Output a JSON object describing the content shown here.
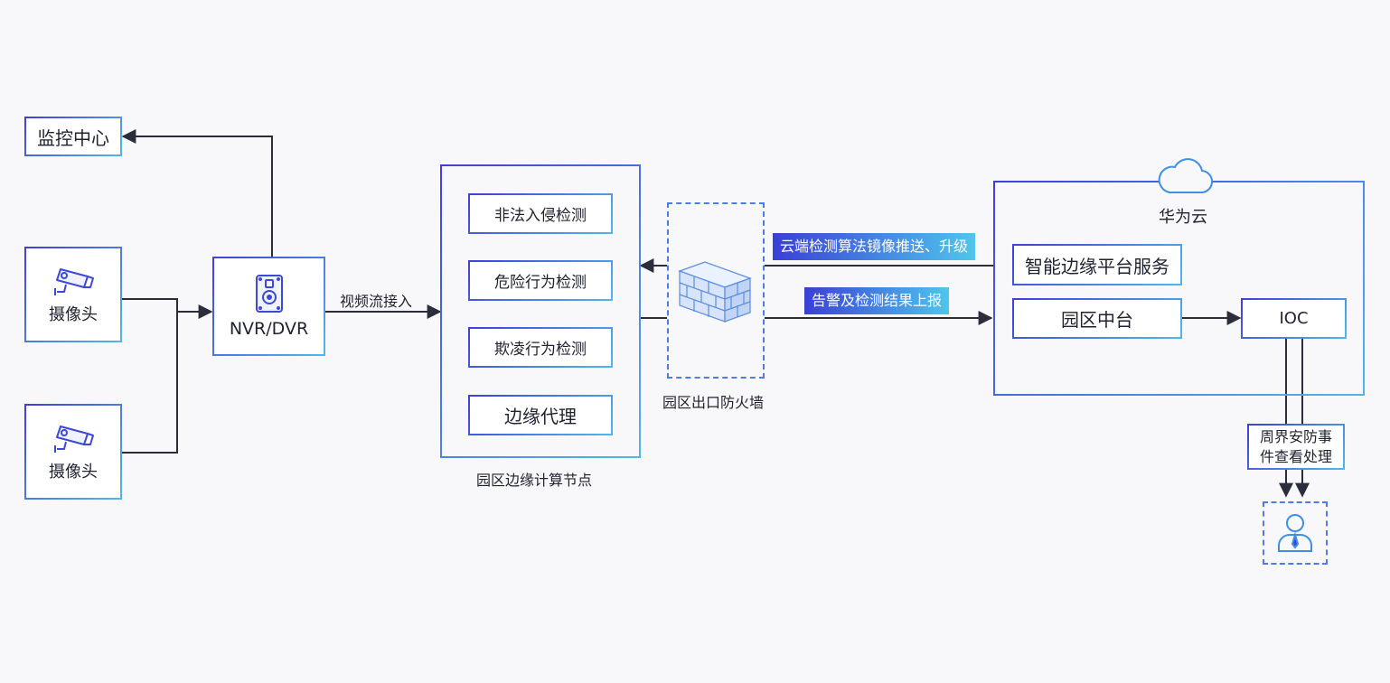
{
  "monitor_center": "监控中心",
  "cameras": [
    {
      "label": "摄像头"
    },
    {
      "label": "摄像头"
    }
  ],
  "nvr": {
    "label": "NVR/DVR"
  },
  "video_stream_label": "视频流接入",
  "edge_node": {
    "caption": "园区边缘计算节点",
    "items": [
      "非法入侵检测",
      "危险行为检测",
      "欺凌行为检测",
      "边缘代理"
    ]
  },
  "firewall": {
    "caption": "园区出口防火墙"
  },
  "arrows": {
    "push": "云端检测算法镜像推送、升级",
    "report": "告警及检测结果上报"
  },
  "cloud": {
    "title": "华为云",
    "items": [
      "智能边缘平台服务",
      "园区中台"
    ],
    "ioc": "IOC"
  },
  "event_handling": {
    "line1": "周界安防事",
    "line2": "件查看处理"
  },
  "colors": {
    "accent_blue": "#3f3fd8",
    "accent_cyan": "#52b6ea",
    "line": "#2b2d3a"
  }
}
